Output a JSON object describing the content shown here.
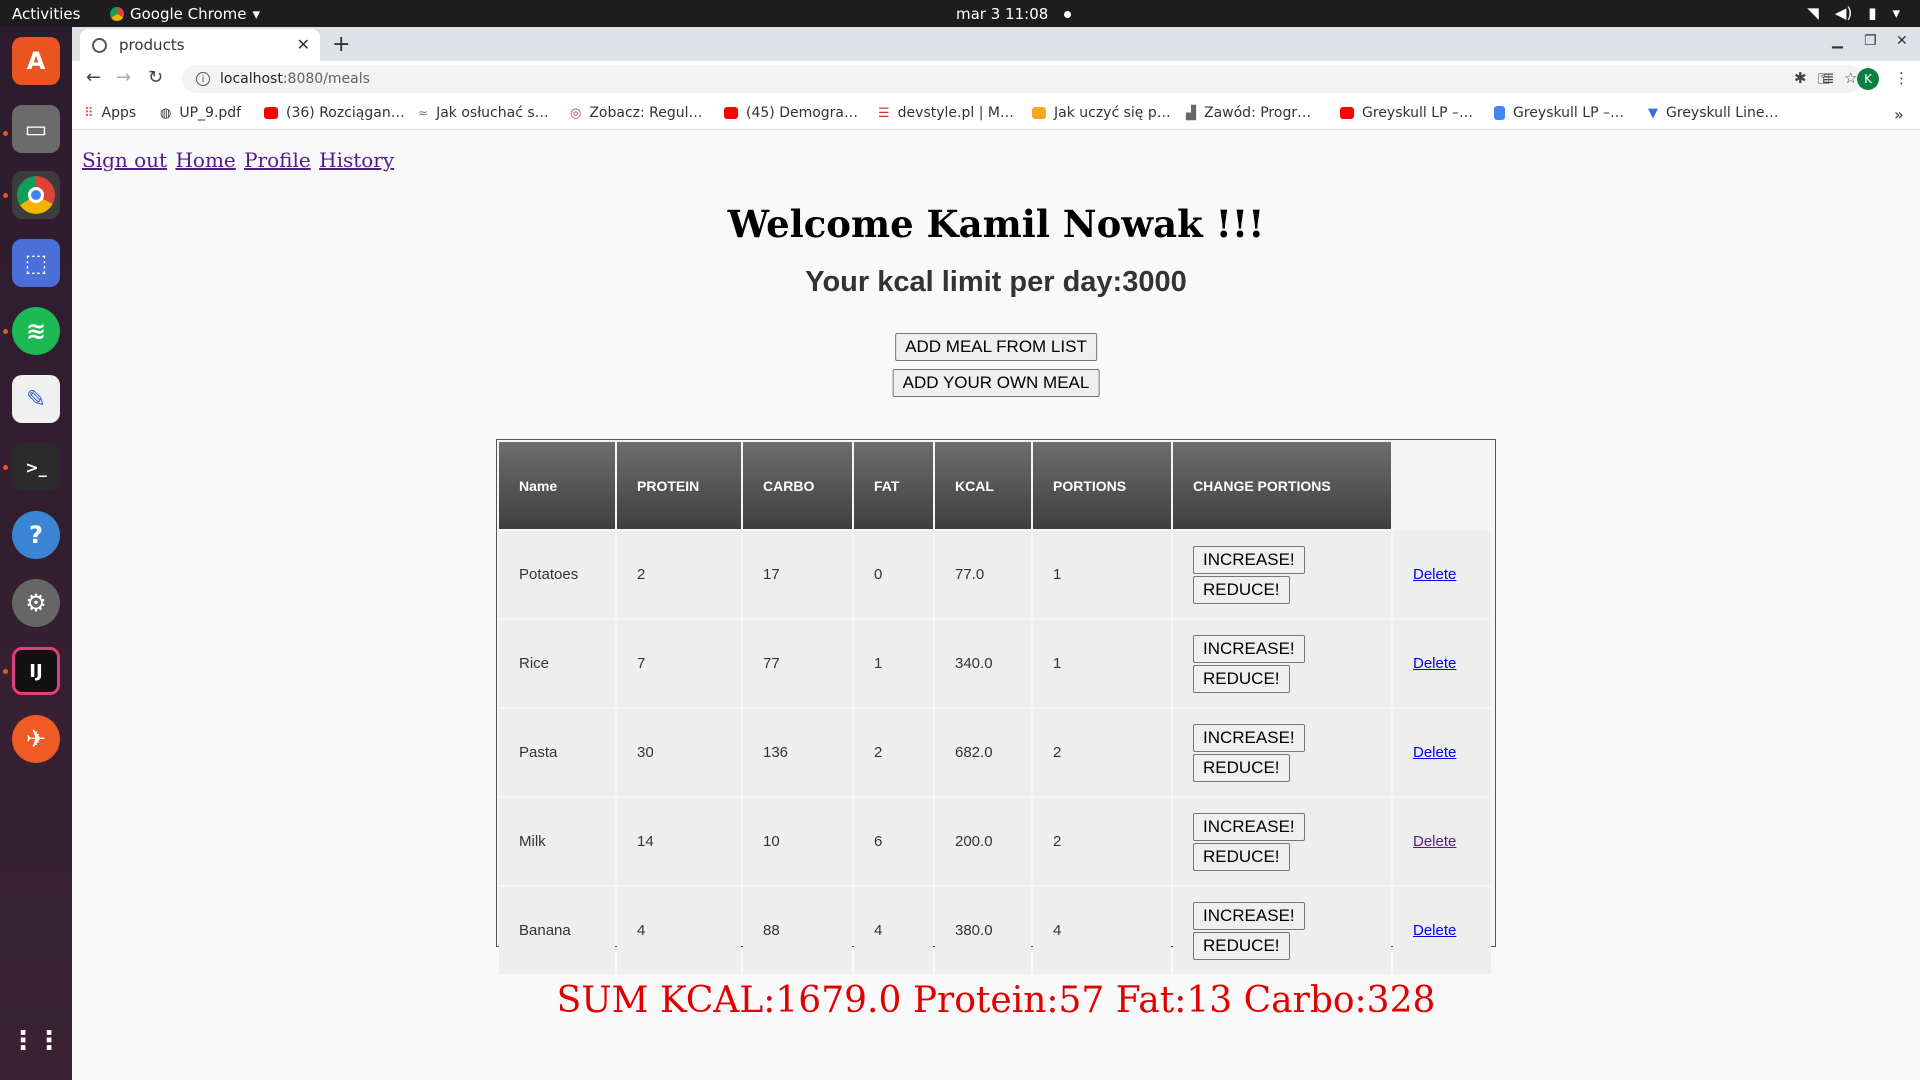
{
  "system": {
    "activities": "Activities",
    "app_name": "Google Chrome",
    "clock": "mar 3  11:08"
  },
  "browser": {
    "tab_title": "products",
    "url_host": "localhost",
    "url_path": ":8080/meals",
    "profile_initial": "K",
    "bookmarks": [
      "Apps",
      "UP_9.pdf",
      "(36) Rozciągan…",
      "Jak osłuchać s…",
      "Zobacz: Regul…",
      "(45) Demogra…",
      "devstyle.pl | M…",
      "Jak uczyć się p…",
      "Zawód: Progr…",
      "Greyskull LP –…",
      "Greyskull LP –…",
      "Greyskull Line…"
    ]
  },
  "nav": {
    "sign_out": "Sign out",
    "home": "Home",
    "profile": "Profile",
    "history": "History"
  },
  "welcome": "Welcome Kamil Nowak !!!",
  "kcal_limit": "Your kcal limit per day:3000",
  "buttons": {
    "add_from_list": "ADD MEAL FROM LIST",
    "add_own": "ADD YOUR OWN MEAL",
    "increase": "INCREASE!",
    "reduce": "REDUCE!",
    "delete": "Delete"
  },
  "table": {
    "headers": [
      "Name",
      "PROTEIN",
      "CARBO",
      "FAT",
      "KCAL",
      "PORTIONS",
      "CHANGE PORTIONS"
    ],
    "rows": [
      {
        "name": "Potatoes",
        "protein": "2",
        "carbo": "17",
        "fat": "0",
        "kcal": "77.0",
        "portions": "1"
      },
      {
        "name": "Rice",
        "protein": "7",
        "carbo": "77",
        "fat": "1",
        "kcal": "340.0",
        "portions": "1"
      },
      {
        "name": "Pasta",
        "protein": "30",
        "carbo": "136",
        "fat": "2",
        "kcal": "682.0",
        "portions": "2"
      },
      {
        "name": "Milk",
        "protein": "14",
        "carbo": "10",
        "fat": "6",
        "kcal": "200.0",
        "portions": "2"
      },
      {
        "name": "Banana",
        "protein": "4",
        "carbo": "88",
        "fat": "4",
        "kcal": "380.0",
        "portions": "4"
      }
    ]
  },
  "summary": "SUM KCAL:1679.0 Protein:57 Fat:13 Carbo:328",
  "colors": {
    "summary_text": "#e00000",
    "header_bg": "#555555",
    "link_visited": "#551a8b",
    "link": "#0000ee"
  }
}
